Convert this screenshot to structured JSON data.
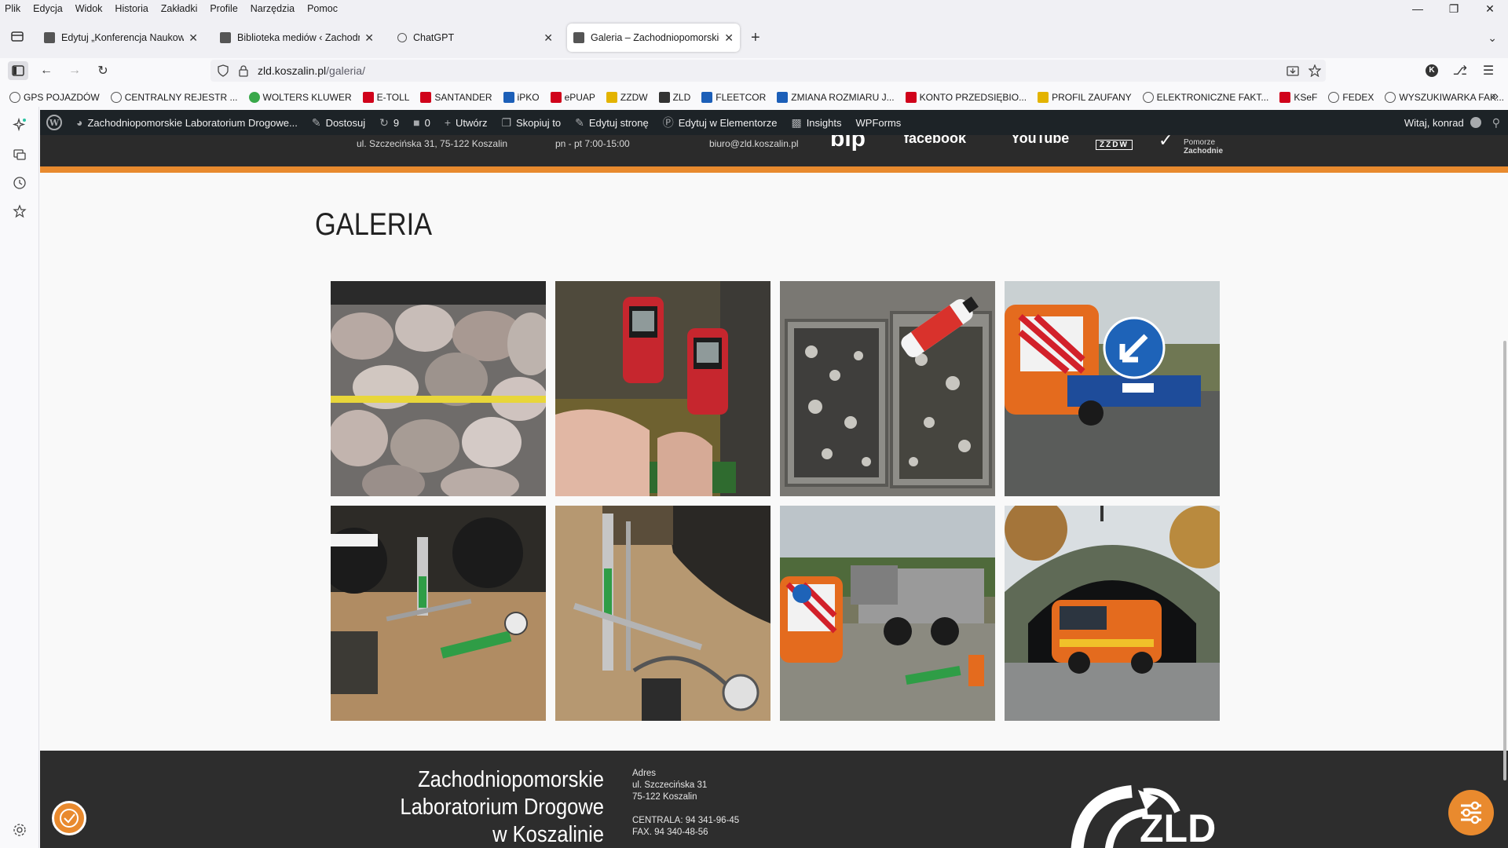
{
  "menubar": {
    "items": [
      "Plik",
      "Edycja",
      "Widok",
      "Historia",
      "Zakładki",
      "Profile",
      "Narzędzia",
      "Pomoc"
    ]
  },
  "tabs": [
    {
      "title": "Edytuj „Konferencja Naukowo –"
    },
    {
      "title": "Biblioteka mediów ‹ Zachodnio"
    },
    {
      "title": "ChatGPT"
    },
    {
      "title": "Galeria – Zachodniopomorskie L"
    }
  ],
  "urlbar": {
    "domain": "zld.koszalin.pl",
    "path": "/galeria/"
  },
  "bookmarks": [
    {
      "label": "GPS POJAZDÓW",
      "icon": "globe-icon"
    },
    {
      "label": "CENTRALNY REJESTR ...",
      "icon": "globe-icon"
    },
    {
      "label": "WOLTERS KLUWER",
      "icon": "wolters-kluwer-icon"
    },
    {
      "label": "E-TOLL",
      "icon": "eagle-icon"
    },
    {
      "label": "SANTANDER",
      "icon": "santander-icon"
    },
    {
      "label": "iPKO",
      "icon": "pko-icon"
    },
    {
      "label": "ePUAP",
      "icon": "epuap-icon"
    },
    {
      "label": "ZZDW",
      "icon": "zzdw-icon"
    },
    {
      "label": "ZLD",
      "icon": "zld-icon"
    },
    {
      "label": "FLEETCOR",
      "icon": "fleetcor-icon"
    },
    {
      "label": "ZMIANA ROZMIARU J...",
      "icon": "resize-icon"
    },
    {
      "label": "KONTO PRZEDSIĘBIO...",
      "icon": "pko-icon"
    },
    {
      "label": "PROFIL ZAUFANY",
      "icon": "profil-zaufany-icon"
    },
    {
      "label": "ELEKTRONICZNE FAKT...",
      "icon": "globe-icon"
    },
    {
      "label": "KSeF",
      "icon": "ksef-icon"
    },
    {
      "label": "FEDEX",
      "icon": "globe-icon"
    },
    {
      "label": "WYSZUKIWARKA FAK...",
      "icon": "globe-icon"
    }
  ],
  "wpbar": {
    "site": "Zachodniopomorskie Laboratorium Drogowe...",
    "customize": "Dostosuj",
    "updates": "9",
    "comments": "0",
    "new": "Utwórz",
    "copy": "Skopiuj to",
    "edit_page": "Edytuj stronę",
    "elementor": "Edytuj w Elementorze",
    "insights": "Insights",
    "wpforms": "WPForms",
    "greeting": "Witaj, konrad"
  },
  "site_header": {
    "address": "ul. Szczecińska 31, 75-122 Koszalin",
    "hours": "pn - pt 7:00-15:00",
    "email": "biuro@zld.koszalin.pl",
    "facebook": "facebook",
    "youtube": "YouTube",
    "zzdw": "ZZDW",
    "pomorze": "Pomorze",
    "zachodnie": "Zachodnie"
  },
  "page": {
    "title": "GALERIA"
  },
  "gallery": [
    {
      "label": "Kruszywo z miarą"
    },
    {
      "label": "Pomiar temperatury pirometrami"
    },
    {
      "label": "Próbki kruszywa w kuwetach"
    },
    {
      "label": "Przyczepa z tablicą ostrzegawczą"
    },
    {
      "label": "Badanie płytą pod samochodem"
    },
    {
      "label": "Obciążenie płytą przy kole"
    },
    {
      "label": "Pomiar przy wywrotce"
    },
    {
      "label": "Służba drogowa w tunelu"
    }
  ],
  "footer": {
    "name_line1": "Zachodniopomorskie",
    "name_line2": "Laboratorium Drogowe",
    "name_line3": "w Koszalinie",
    "address_label": "Adres",
    "street": "ul. Szczecińska 31",
    "city": "75-122 Koszalin",
    "phone": "CENTRALA: 94 341-96-45",
    "fax": "FAX. 94 340-48-56",
    "logo_text": "ZLD"
  },
  "colors": {
    "accent": "#e88a2e",
    "wpbar": "#1d2327",
    "footer": "#2d2d2d"
  }
}
